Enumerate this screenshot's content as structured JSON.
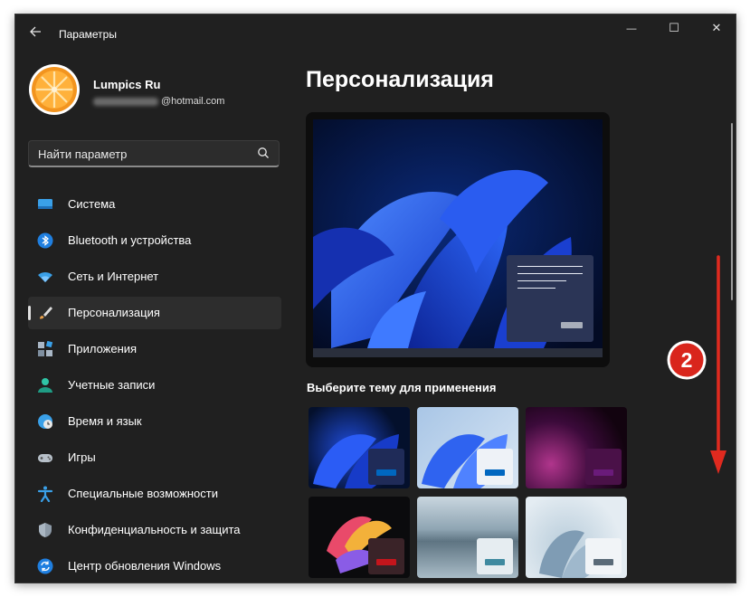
{
  "window": {
    "title": "Параметры",
    "controls": {
      "minimize": "—",
      "maximize": "☐",
      "close": "✕"
    }
  },
  "profile": {
    "name": "Lumpics Ru",
    "email_suffix": "@hotmail.com"
  },
  "search": {
    "placeholder": "Найти параметр"
  },
  "sidebar": {
    "items": [
      {
        "label": "Система",
        "icon": "monitor-icon"
      },
      {
        "label": "Bluetooth и устройства",
        "icon": "bluetooth-icon"
      },
      {
        "label": "Сеть и Интернет",
        "icon": "wifi-icon"
      },
      {
        "label": "Персонализация",
        "icon": "brush-icon",
        "active": true
      },
      {
        "label": "Приложения",
        "icon": "apps-icon"
      },
      {
        "label": "Учетные записи",
        "icon": "person-icon"
      },
      {
        "label": "Время и язык",
        "icon": "clock-globe-icon"
      },
      {
        "label": "Игры",
        "icon": "gamepad-icon"
      },
      {
        "label": "Специальные возможности",
        "icon": "accessibility-icon"
      },
      {
        "label": "Конфиденциальность и защита",
        "icon": "shield-icon"
      },
      {
        "label": "Центр обновления Windows",
        "icon": "update-icon"
      }
    ]
  },
  "main": {
    "title": "Персонализация",
    "theme_section_label": "Выберите тему для применения",
    "themes": [
      {
        "name": "windows-dark",
        "accent": "#0067c0"
      },
      {
        "name": "windows-light",
        "accent": "#0067c0"
      },
      {
        "name": "glow",
        "accent": "#6a1b7a"
      },
      {
        "name": "captured-motion",
        "accent": "#c4151c"
      },
      {
        "name": "sunrise",
        "accent": "#3f8aa0"
      },
      {
        "name": "flow",
        "accent": "#5a6a78"
      }
    ]
  },
  "annotation": {
    "step_number": "2"
  },
  "colors": {
    "window_bg": "#202020",
    "active_item_bg": "#2d2d2d",
    "annotation_red": "#d9251c"
  }
}
